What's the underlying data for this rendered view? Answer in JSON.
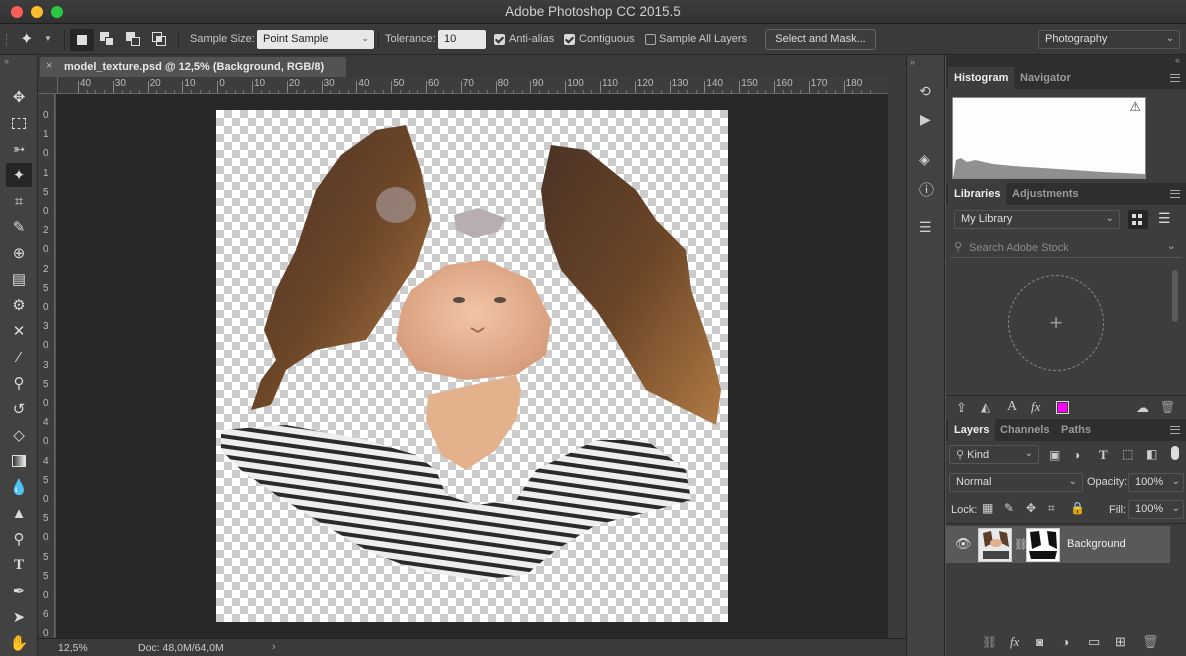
{
  "window": {
    "title": "Adobe Photoshop CC 2015.5"
  },
  "options_bar": {
    "sample_size_label": "Sample Size:",
    "sample_size_value": "Point Sample",
    "tolerance_label": "Tolerance:",
    "tolerance_value": "10",
    "anti_alias_label": "Anti-alias",
    "anti_alias_checked": true,
    "contiguous_label": "Contiguous",
    "contiguous_checked": true,
    "sample_all_layers_label": "Sample All Layers",
    "sample_all_layers_checked": false,
    "select_mask_label": "Select and Mask...",
    "workspace_value": "Photography"
  },
  "document": {
    "tab_title": "model_texture.psd @ 12,5% (Background, RGB/8)",
    "zoom": "12,5%",
    "doc_size": "Doc: 48,0M/64,0M"
  },
  "rulers": {
    "h_ticks": [
      "40",
      "30",
      "20",
      "10",
      "0",
      "10",
      "20",
      "30",
      "40",
      "50",
      "60",
      "70",
      "80",
      "90",
      "100",
      "110",
      "120",
      "130",
      "140",
      "150",
      "160",
      "170",
      "180"
    ],
    "v_ticks": [
      "0",
      "1",
      "0",
      "1",
      "5",
      "0",
      "2",
      "0",
      "2",
      "5",
      "0",
      "3",
      "0",
      "3",
      "5",
      "0",
      "4",
      "0",
      "4",
      "5",
      "0",
      "5",
      "0",
      "5",
      "5",
      "0",
      "6",
      "0"
    ]
  },
  "histogram_panel": {
    "tab_active": "Histogram",
    "tab_inactive": "Navigator",
    "warning": "⚠"
  },
  "libraries_panel": {
    "tab_active": "Libraries",
    "tab_inactive": "Adjustments",
    "library_value": "My Library",
    "search_placeholder": "Search Adobe Stock",
    "add_symbol": "+",
    "swatch_color": "#ff00ff"
  },
  "layers_panel": {
    "tab_active": "Layers",
    "tab_channels": "Channels",
    "tab_paths": "Paths",
    "filter_value": "Kind",
    "blend_mode": "Normal",
    "opacity_label": "Opacity:",
    "opacity_value": "100%",
    "lock_label": "Lock:",
    "fill_label": "Fill:",
    "fill_value": "100%",
    "layer_name": "Background"
  }
}
